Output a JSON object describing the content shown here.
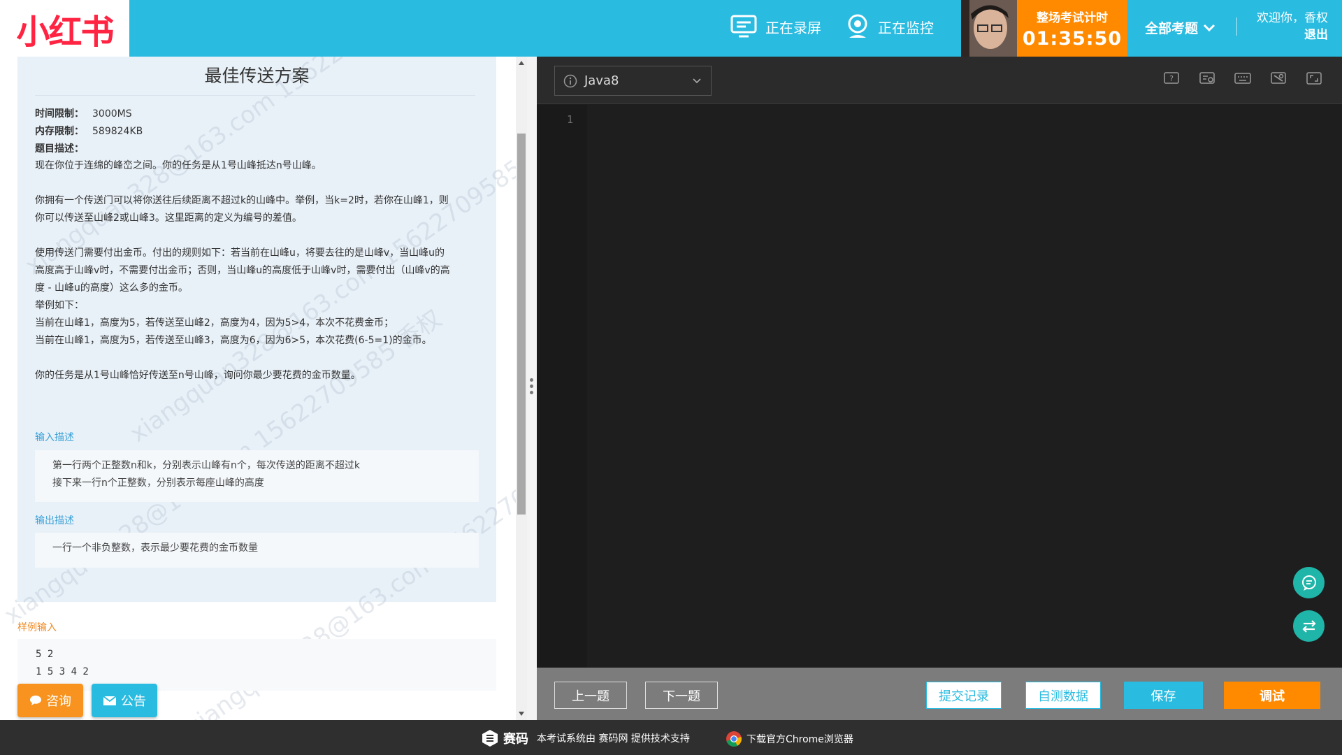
{
  "header": {
    "logo_text": "小红书",
    "recording_label": "正在录屏",
    "monitoring_label": "正在监控",
    "timer_title": "整场考试计时",
    "timer_value": "01:35:50",
    "all_questions_label": "全部考题",
    "welcome_text": "欢迎你，香权",
    "logout_label": "退出"
  },
  "question": {
    "title": "最佳传送方案",
    "time_limit_label": "时间限制：",
    "time_limit_value": "3000MS",
    "memory_limit_label": "内存限制：",
    "memory_limit_value": "589824KB",
    "desc_label": "题目描述：",
    "desc_lines": [
      "现在你位于连绵的峰峦之间。你的任务是从1号山峰抵达n号山峰。",
      "",
      "你拥有一个传送门可以将你送往后续距离不超过k的山峰中。举例，当k=2时，若你在山峰1，则",
      "你可以传送至山峰2或山峰3。这里距离的定义为编号的差值。",
      "",
      "使用传送门需要付出金币。付出的规则如下：若当前在山峰u，将要去往的是山峰v，当山峰u的",
      "高度高于山峰v时，不需要付出金币；否则，当山峰u的高度低于山峰v时，需要付出（山峰v的高",
      "度 - 山峰u的高度）这么多的金币。",
      "举例如下：",
      "当前在山峰1，高度为5，若传送至山峰2，高度为4，因为5>4，本次不花费金币；",
      "当前在山峰1，高度为5，若传送至山峰3，高度为6，因为6>5，本次花费(6-5=1)的金币。",
      "",
      "你的任务是从1号山峰恰好传送至n号山峰，询问你最少要花费的金币数量。"
    ],
    "input_label": "输入描述",
    "input_lines": [
      "第一行两个正整数n和k，分别表示山峰有n个，每次传送的距离不超过k",
      "接下来一行n个正整数，分别表示每座山峰的高度"
    ],
    "output_label": "输出描述",
    "output_text": "一行一个非负整数，表示最少要花费的金币数量",
    "sample_input_label": "样例输入",
    "sample_input_lines": [
      "5 2",
      "1 5 3 4 2"
    ]
  },
  "watermark_text": "xiangquan328@163.com 15622709585 香权",
  "buttons": {
    "consult": "咨询",
    "notice": "公告",
    "prev": "上一题",
    "next": "下一题",
    "submissions": "提交记录",
    "self_test": "自测数据",
    "save": "保存",
    "debug": "调试"
  },
  "editor": {
    "language": "Java8",
    "line_numbers": [
      "1"
    ]
  },
  "footer": {
    "brand": "赛码",
    "support_text": "本考试系统由 赛码网 提供技术支持",
    "chrome_text": "下载官方Chrome浏览器"
  },
  "colors": {
    "header_bg": "#29bbe0",
    "accent_orange": "#ff8a00",
    "logo_red": "#ff2442",
    "fab_teal": "#1fb5a8"
  },
  "icons": [
    "screen-record-icon",
    "webcam-icon",
    "chevron-down-icon",
    "info-icon",
    "help-icon",
    "reset-icon",
    "keyboard-icon",
    "settings-icon",
    "fullscreen-icon",
    "chat-icon",
    "swap-icon",
    "comment-icon",
    "mail-icon",
    "saima-logo-icon",
    "chrome-icon"
  ]
}
